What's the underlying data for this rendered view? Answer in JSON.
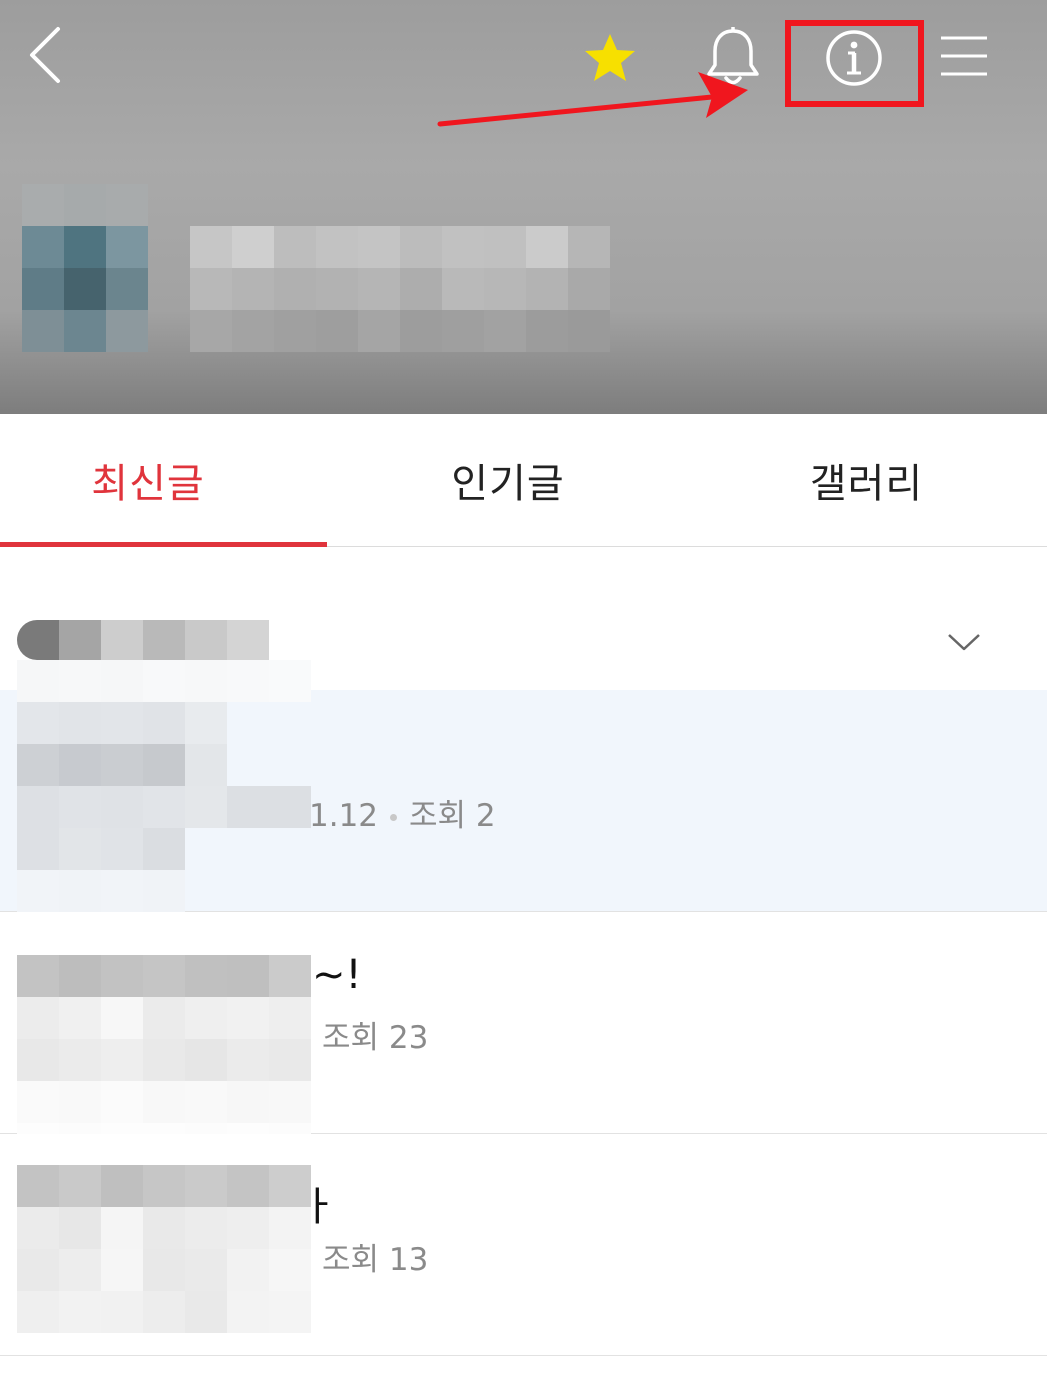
{
  "header": {
    "icons": {
      "back": "back-chevron-icon",
      "favorite": "star-icon",
      "notifications": "bell-icon",
      "info": "info-icon",
      "menu": "hamburger-menu-icon"
    },
    "star_color": "#f7e000",
    "annotation_color": "#f0161e"
  },
  "tabs": [
    {
      "label": "최신글",
      "active": true
    },
    {
      "label": "인기글",
      "active": false
    },
    {
      "label": "갤러리",
      "active": false
    }
  ],
  "accent_color": "#e0343c",
  "filter": {
    "icon": "chevron-down-icon"
  },
  "posts": [
    {
      "title_visible": "",
      "date_fragment": "1.12",
      "views": "조회 2",
      "highlighted": true
    },
    {
      "title_visible": "~!",
      "views": "조회 23",
      "highlighted": false
    },
    {
      "title_visible": "ㅏ",
      "views": "조회 13",
      "highlighted": false
    }
  ]
}
